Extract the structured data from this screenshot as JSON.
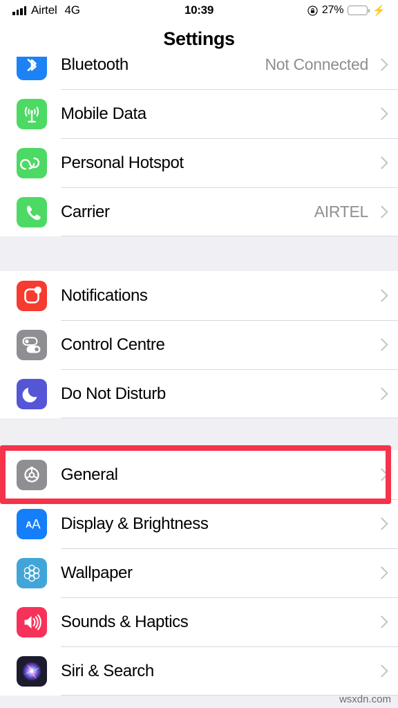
{
  "status_bar": {
    "carrier": "Airtel",
    "network": "4G",
    "time": "10:39",
    "battery_percent": "27%",
    "battery_level": 27,
    "battery_color": "#4cd964",
    "charging": true,
    "rotation_lock_icon": "rotation-lock-icon",
    "signal_icon": "signal-bars-icon",
    "bolt_icon": "charging-bolt-icon"
  },
  "nav": {
    "title": "Settings"
  },
  "colors": {
    "page_background": "#efeff4",
    "row_background": "#ffffff",
    "separator": "#d8d8dc",
    "secondary_text": "#8e8e93",
    "chevron": "#c4c4c7",
    "highlight": "#f5334a"
  },
  "sections": [
    {
      "name": "connectivity",
      "clipped_top": true,
      "rows": [
        {
          "label": "Bluetooth",
          "value": "Not Connected",
          "icon": "bluetooth-icon",
          "icon_color": "#1d82f5"
        },
        {
          "label": "Mobile Data",
          "value": "",
          "icon": "mobile-data-icon",
          "icon_color": "#4cd964"
        },
        {
          "label": "Personal Hotspot",
          "value": "",
          "icon": "personal-hotspot-icon",
          "icon_color": "#4cd964"
        },
        {
          "label": "Carrier",
          "value": "AIRTEL",
          "icon": "carrier-phone-icon",
          "icon_color": "#4cd964"
        }
      ]
    },
    {
      "name": "notifications-group",
      "clipped_top": false,
      "rows": [
        {
          "label": "Notifications",
          "value": "",
          "icon": "notifications-icon",
          "icon_color": "#f63b30"
        },
        {
          "label": "Control Centre",
          "value": "",
          "icon": "control-centre-icon",
          "icon_color": "#8e8e93"
        },
        {
          "label": "Do Not Disturb",
          "value": "",
          "icon": "do-not-disturb-icon",
          "icon_color": "#5456d6"
        }
      ]
    },
    {
      "name": "general-group",
      "clipped_top": false,
      "rows": [
        {
          "label": "General",
          "value": "",
          "icon": "gear-icon",
          "icon_color": "#8e8e93",
          "highlighted": true
        },
        {
          "label": "Display & Brightness",
          "value": "",
          "icon": "display-brightness-icon",
          "icon_color": "#147efb"
        },
        {
          "label": "Wallpaper",
          "value": "",
          "icon": "wallpaper-icon",
          "icon_color": "#42a5d8"
        },
        {
          "label": "Sounds & Haptics",
          "value": "",
          "icon": "sounds-haptics-icon",
          "icon_color": "#f6325a"
        },
        {
          "label": "Siri & Search",
          "value": "",
          "icon": "siri-search-icon",
          "icon_color": "#1c1c2e"
        }
      ]
    }
  ],
  "annotation": {
    "target_row": "General",
    "shape": "rectangle",
    "color": "#f5334a"
  },
  "watermark": {
    "text": "wsxdn.com"
  }
}
